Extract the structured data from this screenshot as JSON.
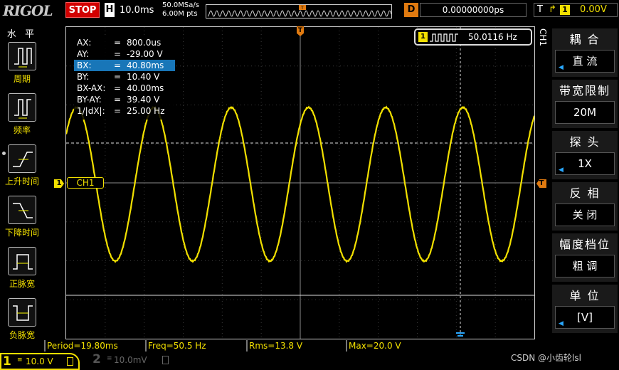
{
  "top": {
    "logo": "RIGOL",
    "run_state": "STOP",
    "timebase_label": "H",
    "timebase_value": "10.0ms",
    "sample_rate": "50.0MSa/s",
    "memory_depth": "6.00M pts",
    "delay_label": "D",
    "delay_value": "0.00000000ps",
    "trigger_label": "T",
    "trigger_channel": "1",
    "trigger_level": "0.00V"
  },
  "left_menu": {
    "title": "水 平",
    "items": [
      {
        "label": "周期"
      },
      {
        "label": "频率"
      },
      {
        "label": "上升时间"
      },
      {
        "label": "下降时间"
      },
      {
        "label": "正脉宽"
      },
      {
        "label": "负脉宽"
      }
    ]
  },
  "cursor_panel": {
    "rows": [
      {
        "key": "AX:",
        "value": "800.0us"
      },
      {
        "key": "AY:",
        "value": "-29.00 V"
      },
      {
        "key": "BX:",
        "value": "40.80ms"
      },
      {
        "key": "BY:",
        "value": "10.40 V"
      },
      {
        "key": "BX-AX:",
        "value": "40.00ms"
      },
      {
        "key": "BY-AY:",
        "value": "39.40 V"
      },
      {
        "key": "1/|dX|:",
        "value": "25.00 Hz"
      }
    ],
    "eq": "="
  },
  "freq_counter": {
    "channel": "1",
    "value": "50.0116 Hz"
  },
  "channel_label": "CH1",
  "channel_marker": "1",
  "trigger_marker": "T",
  "right_menu": {
    "vertical_label": "CH1",
    "items": [
      {
        "title": "耦 合",
        "value": "直 流",
        "has_arrow": true
      },
      {
        "title": "带宽限制",
        "value": "20M",
        "has_arrow": false
      },
      {
        "title": "探 头",
        "value": "1X",
        "has_arrow": true
      },
      {
        "title": "反 相",
        "value": "关 闭",
        "has_arrow": false
      },
      {
        "title": "幅度档位",
        "value": "粗 调",
        "has_arrow": false
      },
      {
        "title": "单 位",
        "value": "[V]",
        "has_arrow": true
      }
    ]
  },
  "measurements": [
    {
      "text": "Period=19.80ms"
    },
    {
      "text": "Freq=50.5 Hz"
    },
    {
      "text": "Rms=13.8 V"
    },
    {
      "text": "Max=20.0 V"
    }
  ],
  "bottom": {
    "ch1_number": "1",
    "ch1_scale": "10.0 V",
    "ch2_number": "2",
    "ch2_scale": "10.0mV",
    "watermark": "CSDN @小齿轮lsl"
  },
  "colors": {
    "ch1": "#f2e000",
    "stop": "#d20000",
    "selected_row": "#1876b8",
    "trigger": "#e07a10"
  },
  "waveform": {
    "frequency_hz": 50.5,
    "amplitude_v": 20.0,
    "timebase_per_div_ms": 10.0
  }
}
